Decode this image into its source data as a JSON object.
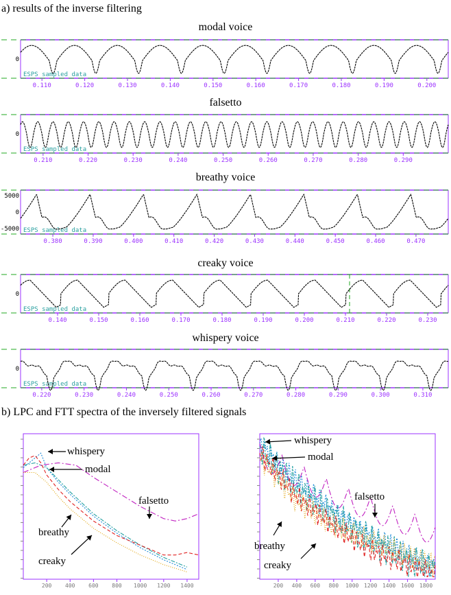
{
  "section_a_title": "a) results of the inverse filtering",
  "section_b_title": "b) LPC and FTT spectra of the inversely filtered signals",
  "colors": {
    "frame": "#9b30ff",
    "marker": "#22aa22",
    "info": "#2aa0a0",
    "trace": "#000000",
    "whispery": "#1c8ad8",
    "modal": "#22a0a0",
    "falsetto": "#c020c0",
    "breathy": "#e02020",
    "creaky": "#e0a000"
  },
  "chart_data": [
    {
      "type": "line",
      "title": "modal voice",
      "info_label": "ESPS sampled data",
      "y_tick_labels": [
        "0"
      ],
      "x_tick_labels": [
        "0.110",
        "0.120",
        "0.130",
        "0.140",
        "0.150",
        "0.160",
        "0.170",
        "0.180",
        "0.190",
        "0.200"
      ],
      "xlim": [
        0.105,
        0.205
      ],
      "cycles": 10,
      "series": [
        {
          "shape": "modal",
          "cycles": 10
        }
      ]
    },
    {
      "type": "line",
      "title": "falsetto",
      "info_label": "ESPS sampled data",
      "y_tick_labels": [
        "0"
      ],
      "x_tick_labels": [
        "0.210",
        "0.220",
        "0.230",
        "0.240",
        "0.250",
        "0.260",
        "0.270",
        "0.280",
        "0.290"
      ],
      "xlim": [
        0.205,
        0.3
      ],
      "cycles": 28,
      "series": [
        {
          "shape": "falsetto",
          "cycles": 28
        }
      ]
    },
    {
      "type": "line",
      "title": "breathy voice",
      "info_label": "ESPS sampled data",
      "y_tick_labels": [
        "5000",
        "0",
        "-5000"
      ],
      "x_tick_labels": [
        "0.380",
        "0.390",
        "0.400",
        "0.410",
        "0.420",
        "0.430",
        "0.440",
        "0.450",
        "0.460",
        "0.470"
      ],
      "xlim": [
        0.372,
        0.478
      ],
      "cycles": 8,
      "series": [
        {
          "shape": "breathy",
          "cycles": 8
        }
      ]
    },
    {
      "type": "line",
      "title": "creaky voice",
      "info_label": "ESPS sampled data",
      "y_tick_labels": [
        "0"
      ],
      "x_tick_labels": [
        "0.140",
        "0.150",
        "0.160",
        "0.170",
        "0.180",
        "0.190",
        "0.200",
        "0.210",
        "0.220",
        "0.230"
      ],
      "xlim": [
        0.131,
        0.235
      ],
      "cycles": 9,
      "series": [
        {
          "shape": "creaky",
          "cycles": 9
        }
      ]
    },
    {
      "type": "line",
      "title": "whispery voice",
      "info_label": "ESPS sampled data",
      "y_tick_labels": [
        "0"
      ],
      "x_tick_labels": [
        "0.220",
        "0.230",
        "0.240",
        "0.250",
        "0.260",
        "0.270",
        "0.280",
        "0.290",
        "0.300",
        "0.310"
      ],
      "xlim": [
        0.215,
        0.316
      ],
      "cycles": 9,
      "series": [
        {
          "shape": "whispery",
          "cycles": 9
        }
      ]
    },
    {
      "type": "line",
      "title": "",
      "kind": "LPC",
      "x_tick_labels": [
        "200",
        "400",
        "600",
        "800",
        "1000",
        "1200",
        "1400"
      ],
      "xlim": [
        0,
        1500
      ],
      "annotations": [
        "whispery",
        "modal",
        "falsetto",
        "breathy",
        "creaky"
      ],
      "series": [
        {
          "name": "whispery",
          "x": [
            0,
            100,
            150,
            200,
            300,
            400,
            600,
            800,
            1000,
            1200,
            1400
          ],
          "y": [
            86,
            90,
            92,
            86,
            80,
            75,
            66,
            59,
            53,
            48,
            44
          ]
        },
        {
          "name": "modal",
          "x": [
            0,
            100,
            200,
            300,
            400,
            600,
            800,
            1000,
            1200,
            1400
          ],
          "y": [
            87,
            88,
            86,
            81,
            76,
            67,
            60,
            54,
            49,
            45
          ]
        },
        {
          "name": "falsetto",
          "x": [
            0,
            150,
            300,
            450,
            600,
            800,
            1000,
            1200,
            1300,
            1400,
            1500
          ],
          "y": [
            84,
            87,
            88,
            87,
            82,
            76,
            70,
            65,
            64,
            65,
            67
          ]
        },
        {
          "name": "breathy",
          "x": [
            0,
            50,
            100,
            150,
            200,
            300,
            400,
            600,
            800,
            1000,
            1200,
            1300,
            1400,
            1500
          ],
          "y": [
            87,
            90,
            91,
            88,
            83,
            77,
            72,
            64,
            58,
            54,
            50,
            50,
            51,
            50
          ]
        },
        {
          "name": "creaky",
          "x": [
            0,
            100,
            200,
            300,
            400,
            600,
            800,
            1000,
            1200,
            1400
          ],
          "y": [
            84,
            84,
            80,
            74,
            69,
            61,
            55,
            50,
            46,
            43
          ]
        }
      ],
      "ylim": [
        40,
        100
      ]
    },
    {
      "type": "line",
      "title": "",
      "kind": "FFT",
      "x_tick_labels": [
        "200",
        "400",
        "600",
        "800",
        "1000",
        "1200",
        "1400",
        "1600",
        "1800"
      ],
      "xlim": [
        0,
        1900
      ],
      "annotations": [
        "whispery",
        "modal",
        "falsetto",
        "breathy",
        "creaky"
      ],
      "series": [
        {
          "name": "whispery",
          "trend": [
            [
              0,
              96
            ],
            [
              400,
              80
            ],
            [
              800,
              68
            ],
            [
              1200,
              58
            ],
            [
              1600,
              50
            ],
            [
              1900,
              45
            ]
          ]
        },
        {
          "name": "modal",
          "trend": [
            [
              0,
              94
            ],
            [
              400,
              78
            ],
            [
              800,
              66
            ],
            [
              1200,
              56
            ],
            [
              1600,
              48
            ],
            [
              1900,
              44
            ]
          ]
        },
        {
          "name": "falsetto",
          "trend": [
            [
              0,
              92
            ],
            [
              400,
              84
            ],
            [
              800,
              76
            ],
            [
              1200,
              70
            ],
            [
              1600,
              64
            ],
            [
              1900,
              60
            ]
          ]
        },
        {
          "name": "breathy",
          "trend": [
            [
              0,
              92
            ],
            [
              400,
              74
            ],
            [
              800,
              62
            ],
            [
              1200,
              52
            ],
            [
              1600,
              46
            ],
            [
              1900,
              42
            ]
          ]
        },
        {
          "name": "creaky",
          "trend": [
            [
              0,
              90
            ],
            [
              400,
              72
            ],
            [
              800,
              62
            ],
            [
              1200,
              56
            ],
            [
              1600,
              50
            ],
            [
              1900,
              46
            ]
          ]
        }
      ],
      "ylim": [
        40,
        100
      ]
    }
  ]
}
